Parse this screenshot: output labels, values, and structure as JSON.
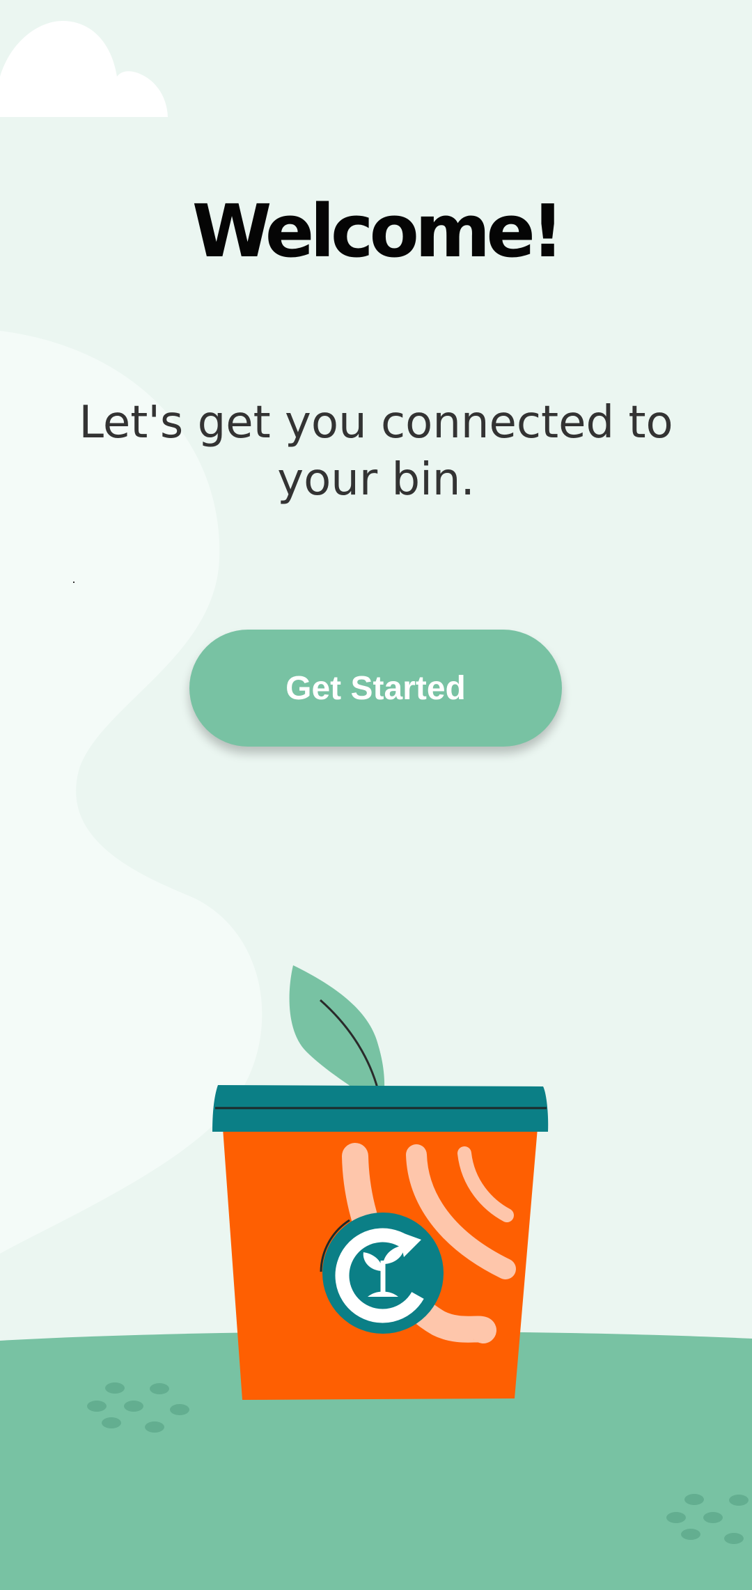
{
  "welcome": {
    "title": "Welcome!",
    "subtitle": "Let's get you connected to your bin."
  },
  "actions": {
    "get_started_label": "Get Started"
  },
  "colors": {
    "background": "#ebf6f1",
    "accent": "#78c2a3",
    "bin_orange": "#fe5f02",
    "lid_teal": "#0b7f86",
    "ground_green": "#78c2a3"
  },
  "icons": [
    "cloud-icon",
    "leaf-icon",
    "compost-bin-icon",
    "recycle-plant-icon"
  ]
}
